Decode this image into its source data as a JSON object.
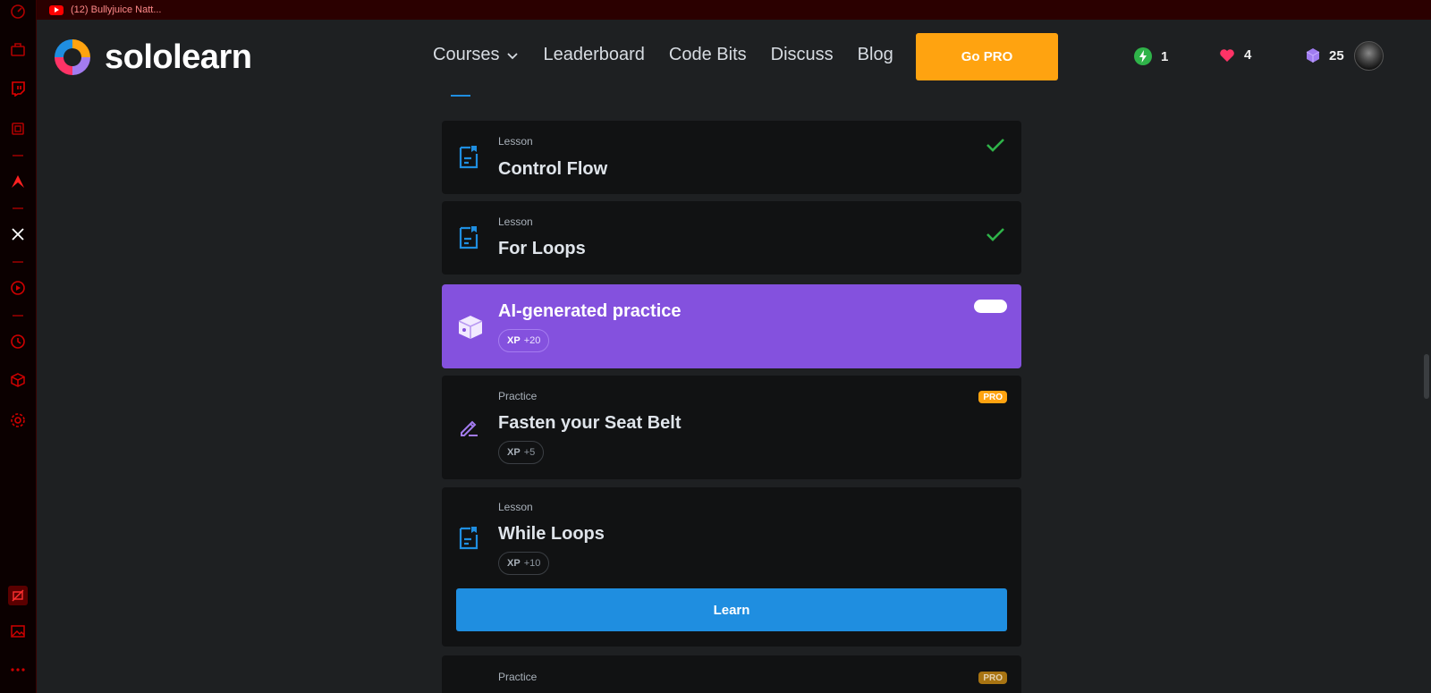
{
  "browser": {
    "tab_title": "(12) Bullyjuice Natt...",
    "sidebar_icons": [
      "speed-dial-icon",
      "briefcase-icon",
      "twitch-icon",
      "cpu-icon",
      "aria-icon",
      "x-icon",
      "player-icon",
      "history-icon",
      "cube-icon",
      "settings-icon",
      "no-video-icon",
      "gallery-icon",
      "more-icon"
    ]
  },
  "header": {
    "logo_text": "sololearn",
    "nav": {
      "courses": "Courses",
      "leaderboard": "Leaderboard",
      "code_bits": "Code Bits",
      "discuss": "Discuss",
      "blog": "Blog"
    },
    "go_pro": "Go PRO",
    "stats": {
      "streak": "1",
      "hearts": "4",
      "gems": "25"
    },
    "colors": {
      "accent": "#ffa310",
      "streak": "#2fb349",
      "heart": "#ff3366",
      "gem": "#a07cf0"
    }
  },
  "lessons": [
    {
      "kind": "Lesson",
      "title": "Control Flow",
      "completed": true
    },
    {
      "kind": "Lesson",
      "title": "For Loops",
      "completed": true
    },
    {
      "kind": "",
      "title": "AI-generated practice",
      "xp_label": "XP",
      "xp_value": "+20"
    },
    {
      "kind": "Practice",
      "title": "Fasten your Seat Belt",
      "xp_label": "XP",
      "xp_value": "+5",
      "badge": "PRO"
    },
    {
      "kind": "Lesson",
      "title": "While Loops",
      "xp_label": "XP",
      "xp_value": "+10",
      "button": "Learn"
    },
    {
      "kind": "Practice",
      "title": "",
      "badge": "PRO"
    }
  ]
}
